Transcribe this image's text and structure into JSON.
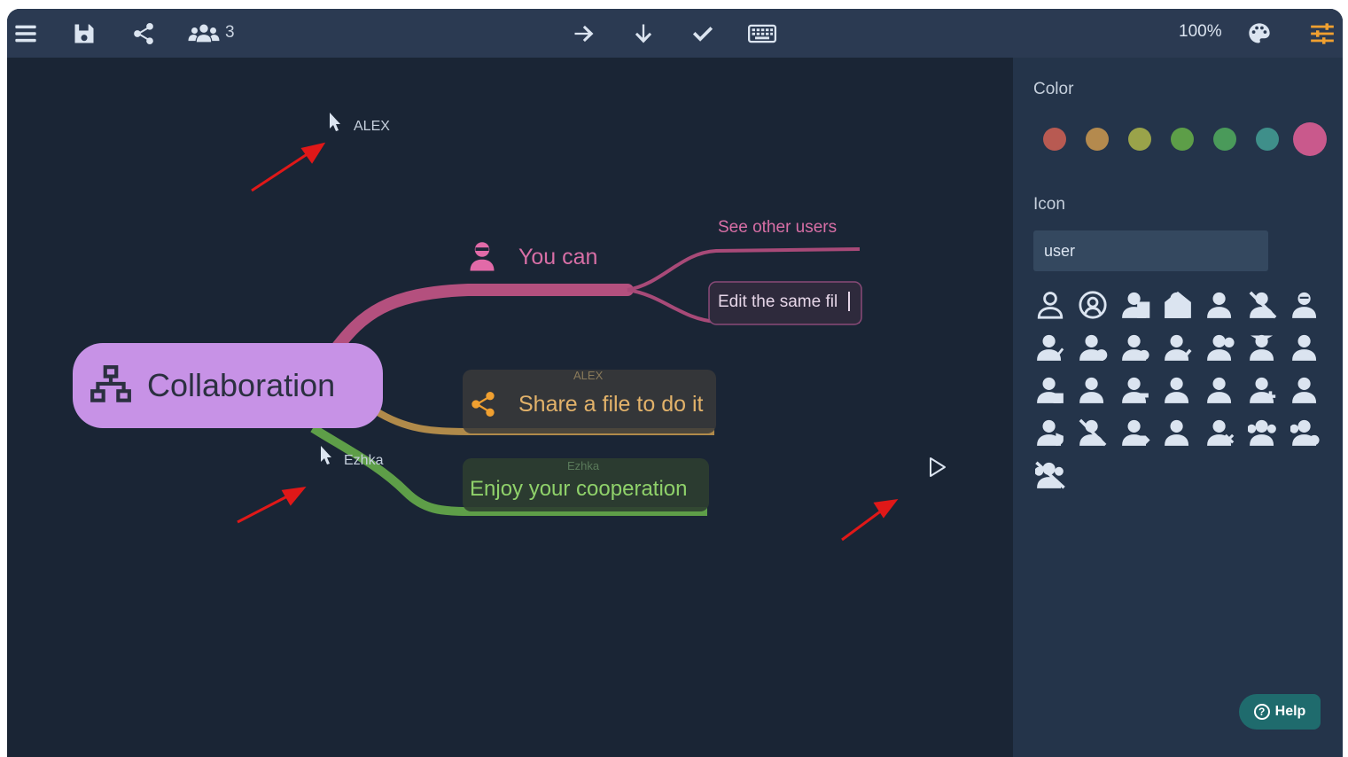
{
  "toolbar": {
    "collaborators_count": "3",
    "zoom": "100%",
    "icons": [
      "menu-icon",
      "save-icon",
      "share-icon",
      "users-icon",
      "arrow-right-icon",
      "arrow-down-icon",
      "check-icon",
      "keyboard-icon",
      "palette-icon",
      "sliders-icon"
    ]
  },
  "mindmap": {
    "central": {
      "label": "Collaboration",
      "icon": "sitemap-icon",
      "color": "#c792e6"
    },
    "you_can": {
      "label": "You can",
      "icon": "user-ninja-icon",
      "color": "#d86fa6"
    },
    "see_other_users": {
      "label": "See other users",
      "color": "#d86fa6"
    },
    "edit_same_file": {
      "label": "Edit the same fil",
      "color": "#e6d6e8"
    },
    "share_file": {
      "label": "Share a file to do it",
      "editor": "ALEX",
      "icon": "share-icon",
      "color": "#e2b26a"
    },
    "enjoy": {
      "label": "Enjoy your cooperation",
      "editor": "Ezhka",
      "color": "#8fd16a"
    }
  },
  "cursors": [
    {
      "name": "ALEX"
    },
    {
      "name": "Ezhka"
    }
  ],
  "panel": {
    "color_label": "Color",
    "colors": [
      "#b85a52",
      "#b48a4e",
      "#9aa34a",
      "#5d9e48",
      "#4a9a5a",
      "#3f8f8a",
      "#c9598c"
    ],
    "selected_color": "#c9598c",
    "icon_label": "Icon",
    "icon_search_value": "user",
    "icons": [
      "user-outline-icon",
      "user-circle-icon",
      "users-building-icon",
      "house-user-icon",
      "user-icon",
      "user-slash-icon",
      "user-astronaut-icon",
      "user-check-icon",
      "user-clock-icon",
      "user-cog-icon",
      "user-edit-icon",
      "user-friends-icon",
      "user-graduate-icon",
      "user-injured-icon",
      "user-lock-icon",
      "user-md-icon",
      "user-minus-icon",
      "user-ninja-icon",
      "user-nurse-icon",
      "user-plus-icon",
      "user-secret-icon",
      "user-shield-icon",
      "user-slash-bold-icon",
      "user-tag-icon",
      "user-tie-icon",
      "user-times-icon",
      "users-icon",
      "users-cog-icon",
      "users-slash-icon"
    ],
    "help_label": "Help"
  }
}
